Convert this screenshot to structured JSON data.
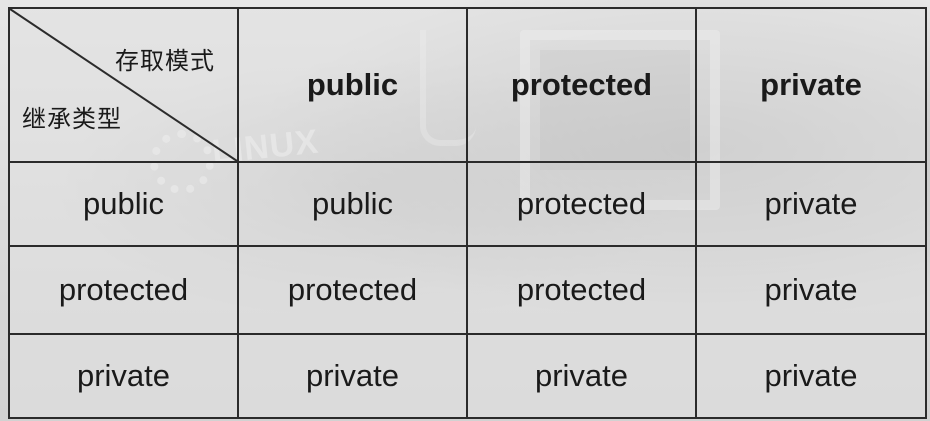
{
  "corner": {
    "top_label": "存取模式",
    "bottom_label": "继承类型"
  },
  "columns": [
    "public",
    "protected",
    "private"
  ],
  "rows": [
    {
      "label": "public",
      "cells": [
        "public",
        "protected",
        "private"
      ]
    },
    {
      "label": "protected",
      "cells": [
        "protected",
        "protected",
        "private"
      ]
    },
    {
      "label": "private",
      "cells": [
        "private",
        "private",
        "private"
      ]
    }
  ],
  "watermark": {
    "logo_text": "LINUX"
  }
}
